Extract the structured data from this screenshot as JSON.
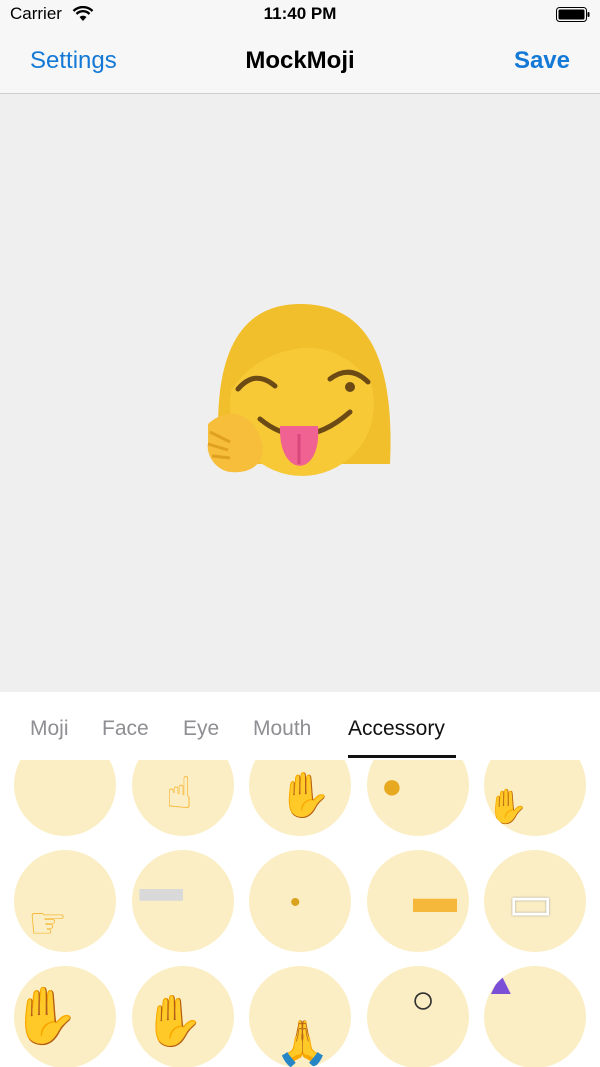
{
  "status": {
    "carrier": "Carrier",
    "time": "11:40 PM"
  },
  "nav": {
    "left": "Settings",
    "title": "MockMoji",
    "right": "Save"
  },
  "tabs": [
    "Moji",
    "Face",
    "Eye",
    "Mouth",
    "Accessory"
  ],
  "active_tab": "Accessory",
  "accessories": [
    {
      "name": "empty-top",
      "glyph": ""
    },
    {
      "name": "pointing-up-hand",
      "glyph": "☝"
    },
    {
      "name": "waving-hand",
      "glyph": "✋"
    },
    {
      "name": "thumb-shape",
      "glyph": "●"
    },
    {
      "name": "small-wave-hand",
      "glyph": "✋"
    },
    {
      "name": "pointing-hand",
      "glyph": "☞"
    },
    {
      "name": "bandage",
      "glyph": "━"
    },
    {
      "name": "dot",
      "glyph": "•"
    },
    {
      "name": "cigarette",
      "glyph": "▬"
    },
    {
      "name": "face-mask",
      "glyph": "▭"
    },
    {
      "name": "raised-hand-left",
      "glyph": "✋"
    },
    {
      "name": "raised-hand-right",
      "glyph": "✋"
    },
    {
      "name": "praying-hands",
      "glyph": "🙏"
    },
    {
      "name": "monocle",
      "glyph": "○"
    },
    {
      "name": "party-hat",
      "glyph": "▲"
    }
  ],
  "colors": {
    "accent": "#1479d6",
    "cell": "#fbeec4",
    "emoji": "#f7c937"
  }
}
